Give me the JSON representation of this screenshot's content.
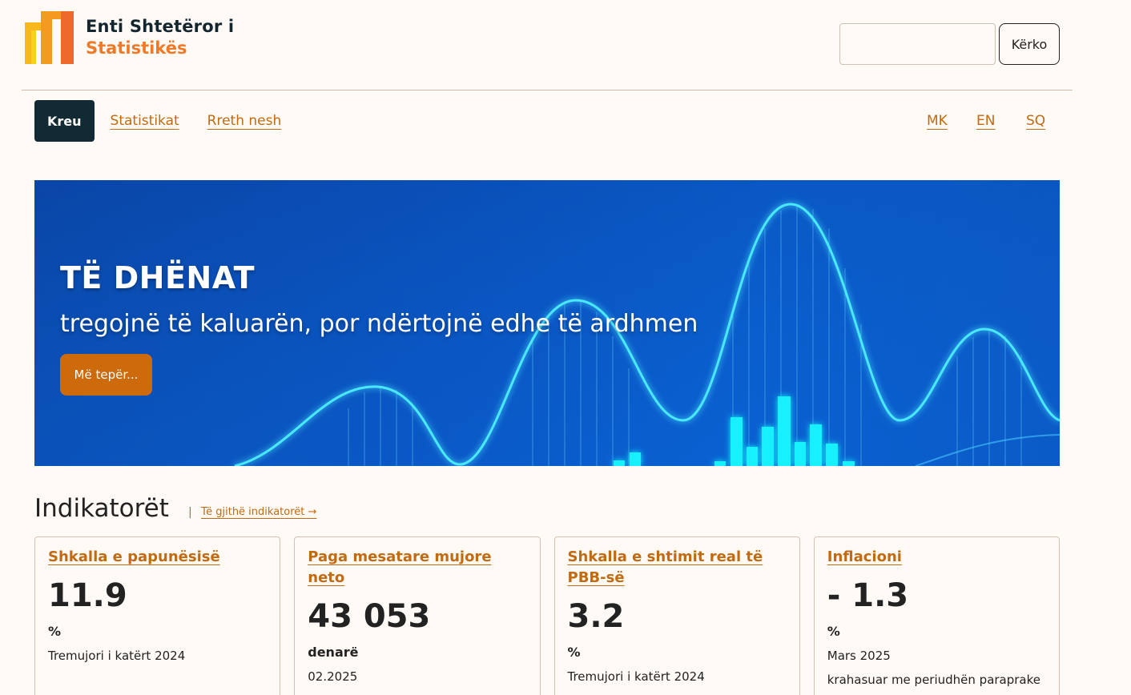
{
  "header": {
    "logo_line1": "Enti Shtetëror i",
    "logo_line2": "Statistikës",
    "search_placeholder": "",
    "search_button": "Kërko"
  },
  "nav": {
    "items": [
      {
        "label": "Kreu",
        "active": true
      },
      {
        "label": "Statistikat",
        "active": false
      },
      {
        "label": "Rreth nesh",
        "active": false
      }
    ],
    "languages": [
      "MK",
      "EN",
      "SQ"
    ]
  },
  "hero": {
    "title": "TË DHËNAT",
    "subtitle": "tregojnë të kaluarën, por ndërtojnë edhe të ardhmen",
    "button": "Më tepër..."
  },
  "indicators": {
    "title": "Indikatorët",
    "separator": "|",
    "all_link": "Të gjithë indikatorët →",
    "cards": [
      {
        "title": "Shkalla e papunësisë",
        "value": "11.9",
        "unit": "%",
        "period": "Tremujori i katërt 2024",
        "note": ""
      },
      {
        "title": "Paga mesatare mujore neto",
        "value": "43 053",
        "unit": "denarë",
        "period": "02.2025",
        "note": ""
      },
      {
        "title": "Shkalla e shtimit real të PBB-së",
        "value": "3.2",
        "unit": "%",
        "period": "Tremujori i katërt 2024",
        "note": ""
      },
      {
        "title": "Inflacioni",
        "value": "- 1.3",
        "unit": "%",
        "period": "Mars 2025",
        "note": "krahasuar me periudhën paraprake"
      }
    ]
  },
  "colors": {
    "accent": "#c16a10",
    "dark": "#122a33",
    "hero_blue": "#0a56c5",
    "glow": "#33e6ff"
  }
}
